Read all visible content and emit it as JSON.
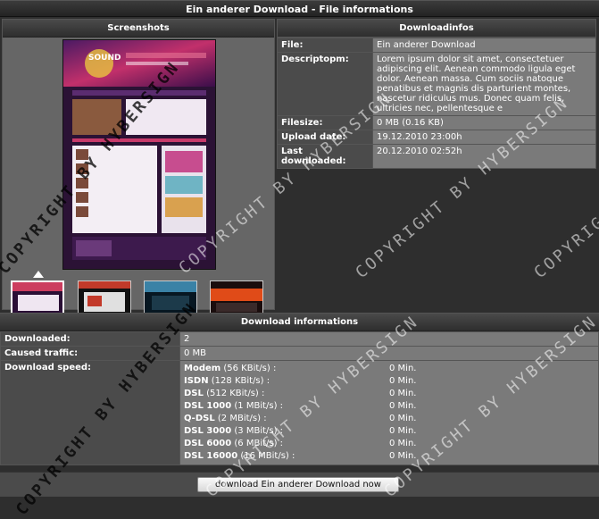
{
  "page": {
    "title": "Ein anderer Download - File informations"
  },
  "screenshots": {
    "heading": "Screenshots",
    "main_title": "SOUND",
    "thumbnails": [
      {
        "name": "thumb-1",
        "colors": [
          "#2a0f35",
          "#cc3d5f"
        ]
      },
      {
        "name": "thumb-2",
        "colors": [
          "#111111",
          "#c23a2a"
        ]
      },
      {
        "name": "thumb-3",
        "colors": [
          "#071722",
          "#3a82a6"
        ]
      },
      {
        "name": "thumb-4",
        "colors": [
          "#1a0d0d",
          "#e04b18"
        ]
      }
    ]
  },
  "downloadinfos": {
    "heading": "Downloadinfos",
    "rows": [
      {
        "key": "File:",
        "value": "Ein anderer Download"
      },
      {
        "key": "Descriptopm:",
        "value": "Lorem ipsum dolor sit amet, consectetuer adipiscing elit. Aenean commodo ligula eget dolor. Aenean massa. Cum sociis natoque penatibus et magnis dis parturient montes, nascetur ridiculus mus. Donec quam felis, ultricies nec, pellentesque e"
      },
      {
        "key": "Filesize:",
        "value": "0 MB (0.16 KB)"
      },
      {
        "key": "Upload date:",
        "value": "19.12.2010 23:00h"
      },
      {
        "key": "Last downloaded:",
        "value": "20.12.2010 02:52h"
      }
    ]
  },
  "download_info": {
    "heading": "Download informations",
    "downloaded_label": "Downloaded:",
    "downloaded_value": "2",
    "traffic_label": "Caused traffic:",
    "traffic_value": "0 MB",
    "speed_label": "Download speed:",
    "speeds": [
      {
        "name": "Modem",
        "rate": "(56 KBit/s) :",
        "time": "0 Min."
      },
      {
        "name": "ISDN",
        "rate": "(128 KBit/s) :",
        "time": "0 Min."
      },
      {
        "name": "DSL",
        "rate": "(512 KBit/s) :",
        "time": "0 Min."
      },
      {
        "name": "DSL 1000",
        "rate": "(1 MBit/s) :",
        "time": "0 Min."
      },
      {
        "name": "Q-DSL",
        "rate": "(2 MBit/s) :",
        "time": "0 Min."
      },
      {
        "name": "DSL 3000",
        "rate": "(3 MBit/s) :",
        "time": "0 Min."
      },
      {
        "name": "DSL 6000",
        "rate": "(6 MBit/s) :",
        "time": "0 Min."
      },
      {
        "name": "DSL 16000",
        "rate": "(16 MBit/s) :",
        "time": "0 Min."
      }
    ]
  },
  "footer": {
    "button_label": "download Ein anderer Download now"
  },
  "watermark": {
    "text": "COPYRIGHT BY HYBERSIGN"
  }
}
